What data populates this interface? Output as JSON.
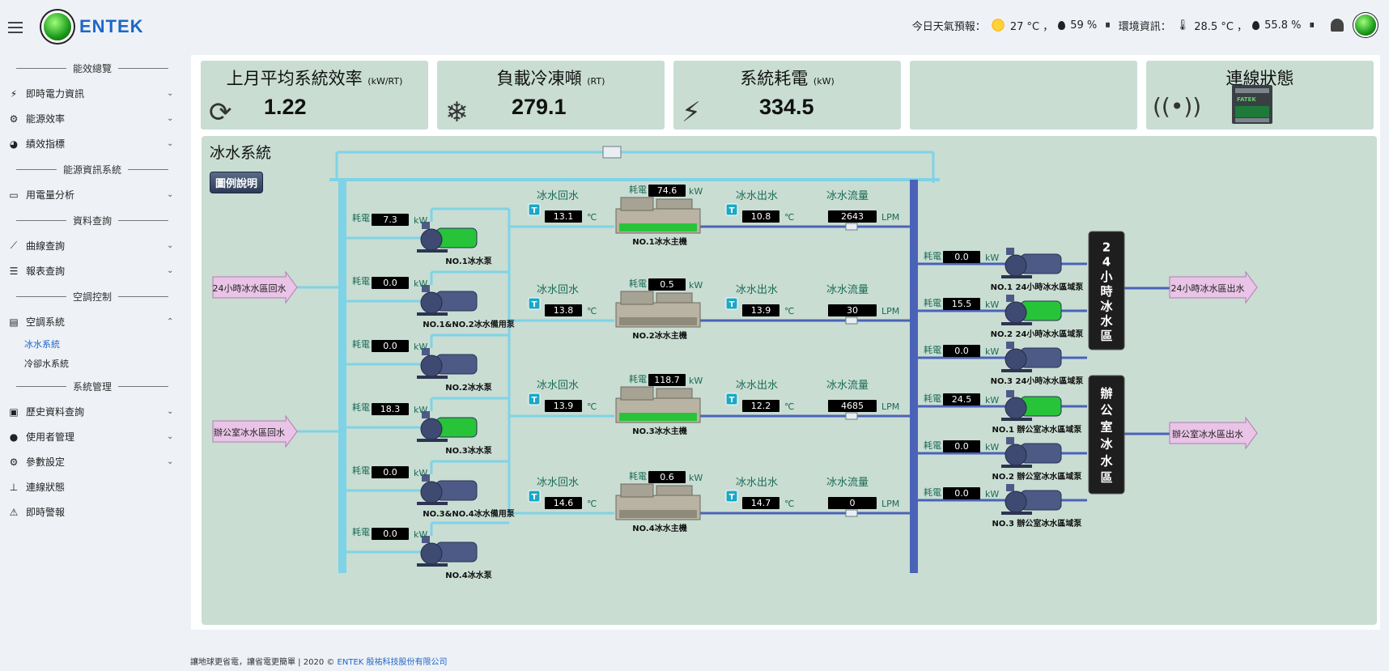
{
  "app": {
    "name": "ENTEK"
  },
  "header": {
    "weather_label": "今日天氣預報：",
    "weather_temp": "27 °C ，",
    "weather_humidity": "59 %",
    "env_label": "環境資訊：",
    "env_temp": "28.5 °C ，",
    "env_humidity": "55.8 %",
    "sep": "⏸"
  },
  "sidebar": {
    "sections": [
      {
        "head": "能效總覽",
        "items": [
          {
            "label": "即時電力資訊",
            "icon": "⚡",
            "chevron": "⌄"
          },
          {
            "label": "能源效率",
            "icon": "⚙",
            "chevron": "⌄"
          },
          {
            "label": "績效指標",
            "icon": "◕",
            "chevron": "⌄"
          }
        ]
      },
      {
        "head": "能源資訊系統",
        "items": [
          {
            "label": "用電量分析",
            "icon": "▭",
            "chevron": "⌄"
          }
        ]
      },
      {
        "head": "資料查詢",
        "items": [
          {
            "label": "曲線查詢",
            "icon": "⟋",
            "chevron": "⌄"
          },
          {
            "label": "報表查詢",
            "icon": "☰",
            "chevron": "⌄"
          }
        ]
      },
      {
        "head": "空調控制",
        "items": [
          {
            "label": "空調系統",
            "icon": "▤",
            "chevron": "⌃"
          }
        ],
        "subitems": [
          "冰水系統",
          "冷卻水系統"
        ]
      },
      {
        "head": "系統管理",
        "items": [
          {
            "label": "歷史資料查詢",
            "icon": "▣",
            "chevron": "⌄"
          },
          {
            "label": "使用者管理",
            "icon": "●",
            "chevron": "⌄"
          },
          {
            "label": "參數設定",
            "icon": "⚙",
            "chevron": "⌄"
          },
          {
            "label": "連線狀態",
            "icon": "⊥",
            "chevron": ""
          },
          {
            "label": "即時警報",
            "icon": "⚠",
            "chevron": ""
          }
        ]
      }
    ]
  },
  "cards": {
    "efficiency": {
      "title": "上月平均系統效率",
      "unit": "(kW/RT)",
      "value": "1.22"
    },
    "load": {
      "title": "負載冷凍噸",
      "unit": "(RT)",
      "value": "279.1"
    },
    "power": {
      "title": "系統耗電",
      "unit": "(kW)",
      "value": "334.5"
    },
    "connection": {
      "title": "連線狀態",
      "device_text": "FATEK"
    }
  },
  "diagram": {
    "title": "冰水系統",
    "legend_button": "圖例說明",
    "labels": {
      "power": "耗電",
      "kw": "kW",
      "return_water": "冰水回水",
      "supply_water": "冰水出水",
      "flow": "冰水流量",
      "celsius": "℃",
      "lpm": "LPM",
      "t": "T"
    },
    "inlets": [
      "24小時冰水區回水",
      "辦公室冰水區回水"
    ],
    "outlets": [
      "24小時冰水區出水",
      "辦公室冰水區出水"
    ],
    "pumps": [
      {
        "name": "NO.1冰水泵",
        "kw": "7.3",
        "running": true
      },
      {
        "name": "NO.1&NO.2冰水備用泵",
        "kw": "0.0",
        "running": false
      },
      {
        "name": "NO.2冰水泵",
        "kw": "0.0",
        "running": false
      },
      {
        "name": "NO.3冰水泵",
        "kw": "18.3",
        "running": true
      },
      {
        "name": "NO.3&NO.4冰水備用泵",
        "kw": "0.0",
        "running": false
      },
      {
        "name": "NO.4冰水泵",
        "kw": "0.0",
        "running": false
      }
    ],
    "chillers": [
      {
        "name": "NO.1冰水主機",
        "kw": "74.6",
        "ret": "13.1",
        "sup": "10.8",
        "flow": "2643",
        "running": true
      },
      {
        "name": "NO.2冰水主機",
        "kw": "0.5",
        "ret": "13.8",
        "sup": "13.9",
        "flow": "30",
        "running": false
      },
      {
        "name": "NO.3冰水主機",
        "kw": "118.7",
        "ret": "13.9",
        "sup": "12.2",
        "flow": "4685",
        "running": true
      },
      {
        "name": "NO.4冰水主機",
        "kw": "0.6",
        "ret": "14.6",
        "sup": "14.7",
        "flow": "0",
        "running": false
      }
    ],
    "zone_pumps": [
      {
        "name": "NO.1 24小時冰水區域泵",
        "kw": "0.0",
        "running": false
      },
      {
        "name": "NO.2 24小時冰水區域泵",
        "kw": "15.5",
        "running": true
      },
      {
        "name": "NO.3 24小時冰水區域泵",
        "kw": "0.0",
        "running": false
      },
      {
        "name": "NO.1 辦公室冰水區域泵",
        "kw": "24.5",
        "running": true
      },
      {
        "name": "NO.2 辦公室冰水區域泵",
        "kw": "0.0",
        "running": false
      },
      {
        "name": "NO.3 辦公室冰水區域泵",
        "kw": "0.0",
        "running": false
      }
    ],
    "zones": [
      "24小時冰水區",
      "辦公室冰水區"
    ],
    "colors": {
      "pipe_return": "#7fd3e6",
      "pipe_supply": "#4a63b8",
      "panel": "#c9ddd3",
      "run": "#27c43a"
    }
  },
  "footer": {
    "text": "讓地球更省電，讓省電更簡單 | 2020 © ",
    "company": "ENTEK 殷祐科技股份有限公司"
  }
}
